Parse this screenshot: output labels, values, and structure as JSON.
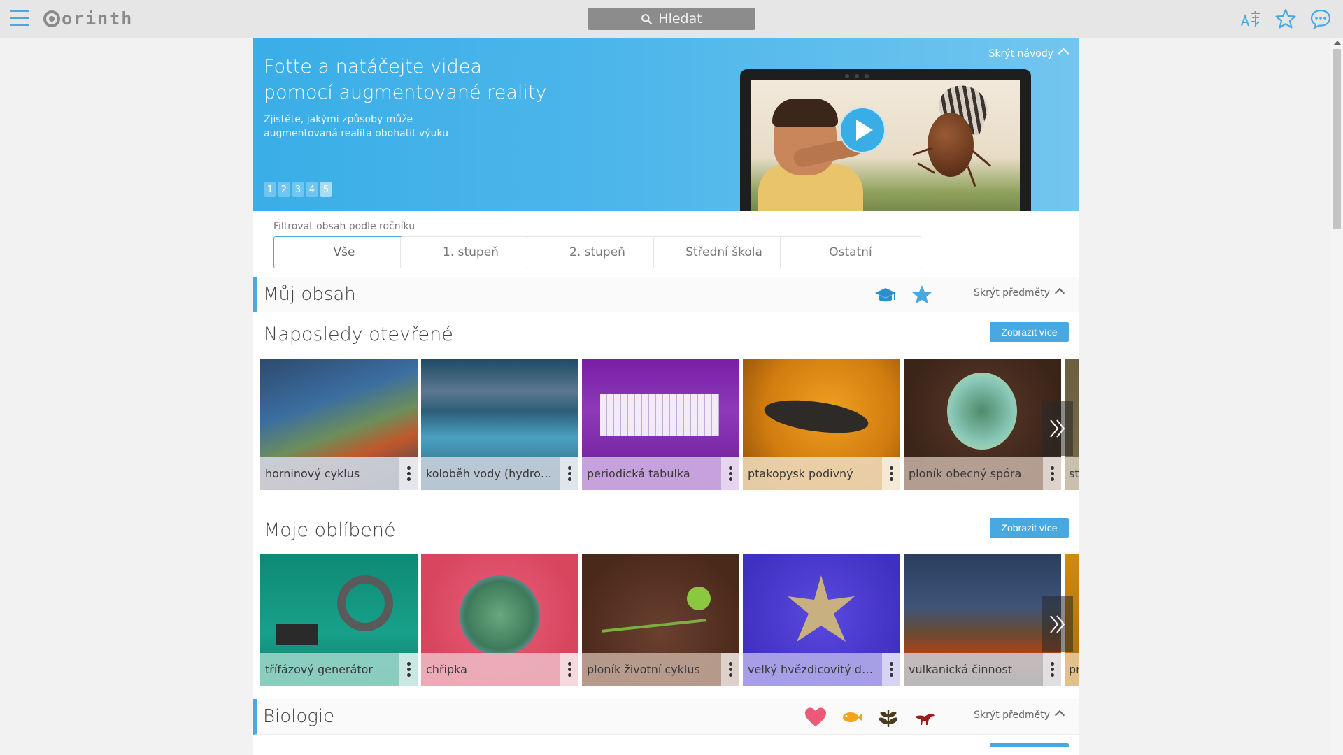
{
  "app": {
    "logo": "orinth"
  },
  "search": {
    "placeholder": "Hledat"
  },
  "topbar_icons": [
    "translate-icon",
    "star-icon",
    "chat-icon"
  ],
  "banner": {
    "title_line1": "Fotte a natáčejte videa",
    "title_line2": "pomocí augmentované reality",
    "subtitle_line1": "Zjistěte, jakými způsoby může",
    "subtitle_line2": "augmentovaná realita obohatit výuku",
    "hide_label": "Skrýt návody",
    "pages": [
      "1",
      "2",
      "3",
      "4",
      "5"
    ],
    "active_page": "5"
  },
  "filter": {
    "label": "Filtrovat obsah podle ročníku",
    "options": [
      "Vše",
      "1. stupeň",
      "2. stupeň",
      "Střední škola",
      "Ostatní"
    ],
    "selected": "Vše"
  },
  "my_content": {
    "title": "Můj obsah",
    "icons": [
      "graduation-cap-icon",
      "star-icon"
    ],
    "hide_label": "Skrýt předměty"
  },
  "recent": {
    "title": "Naposledy otevřené",
    "show_more": "Zobrazit více",
    "items": [
      "horninový cyklus",
      "koloběh vody (hydrol…",
      "periodická tabulka",
      "ptakopysk podivný",
      "ploník obecný spóra"
    ],
    "partial_item": "st"
  },
  "favorites": {
    "title": "Moje oblíbené",
    "show_more": "Zobrazit více",
    "items": [
      "třífázový generátor",
      "chřipka",
      "ploník životní cyklus",
      "velký hvězdicovitý dv…",
      "vulkanická činnost"
    ],
    "partial_item": "pr"
  },
  "biology": {
    "title": "Biologie",
    "icons": [
      "heart-icon",
      "fish-icon",
      "plant-icon",
      "dinosaur-icon"
    ],
    "hide_label": "Skrýt předměty"
  },
  "colors": {
    "accent": "#4aa8e0",
    "banner_start": "#3aaee8",
    "banner_end": "#72c6ef"
  }
}
